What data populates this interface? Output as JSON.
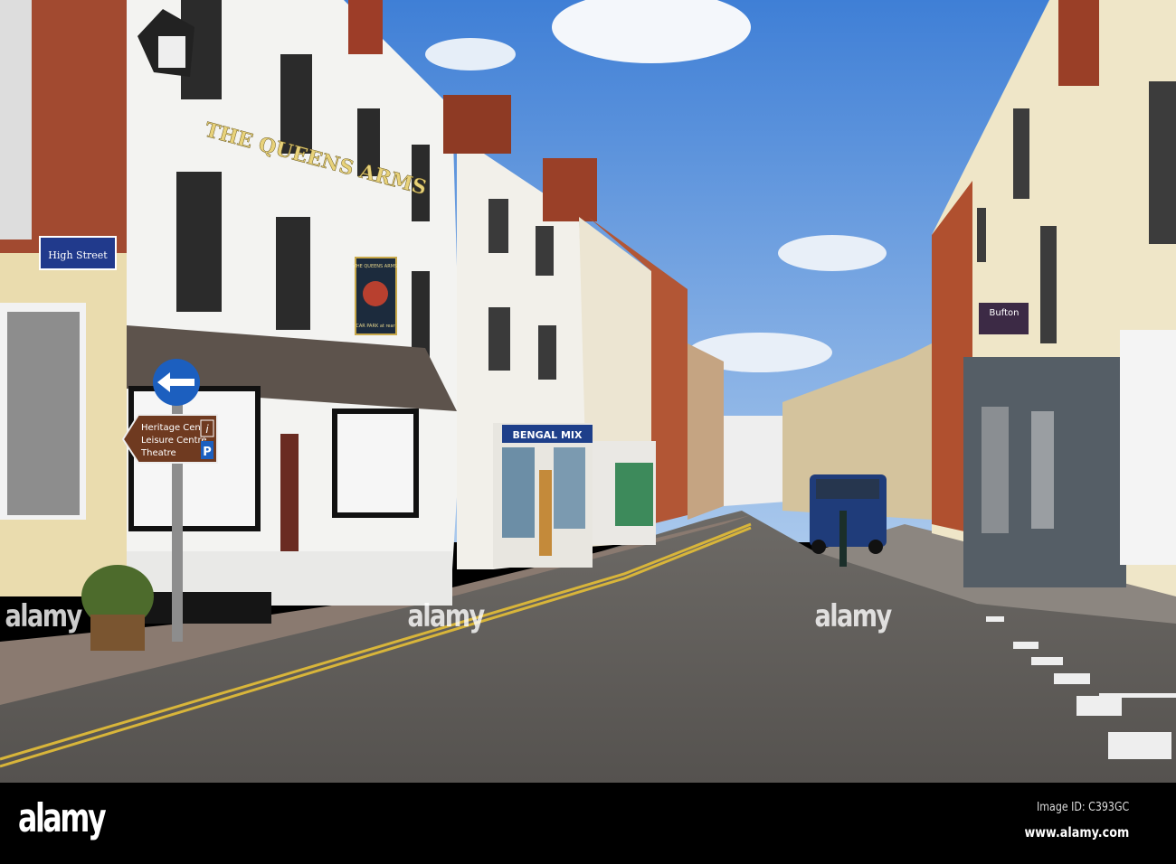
{
  "photo": {
    "pub_sign": "THE QUEENS ARMS",
    "hanging_sign": {
      "top": "THE QUEENS ARMS",
      "bottom": "CAR PARK at rear"
    },
    "street_sign": "High Street",
    "tourist_sign": {
      "lines": [
        "Heritage Centre",
        "Leisure Centre",
        "Theatre"
      ],
      "info": "i",
      "parking": "P"
    },
    "shop_sign": "BENGAL MIX",
    "estate_agent_sign": "Bufton"
  },
  "watermarks": [
    "alamy",
    "alamy",
    "alamy"
  ],
  "footer": {
    "logo": "alamy",
    "image_id": "Image ID: C393GC",
    "url": "www.alamy.com"
  }
}
